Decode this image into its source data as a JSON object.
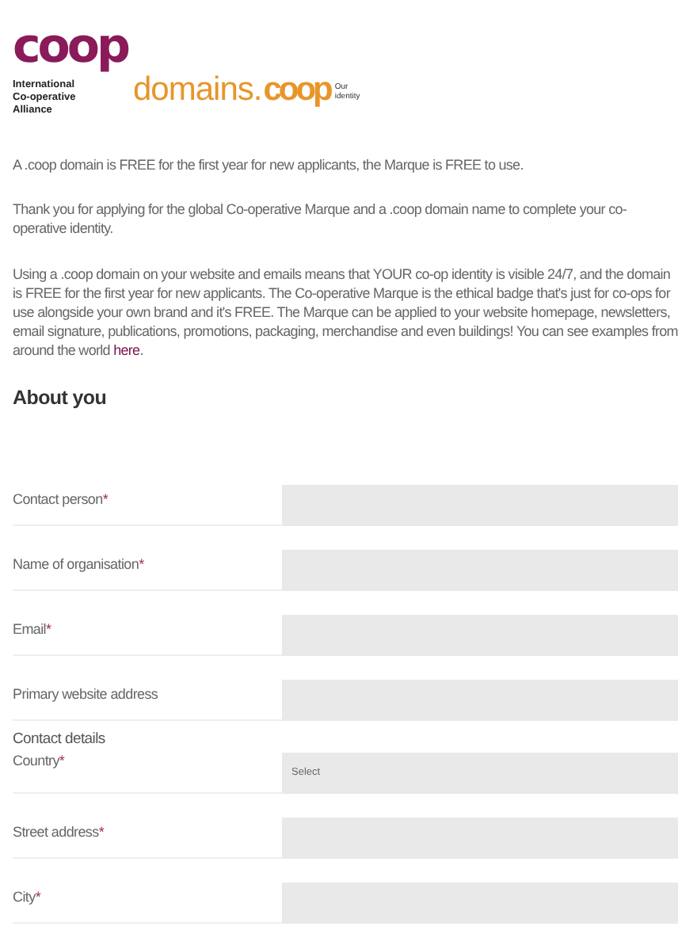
{
  "logo": {
    "mark": "coop",
    "org": [
      "International",
      "Co-operative",
      "Alliance"
    ],
    "domain": "domains.",
    "domain_mark": "coop",
    "tagline": [
      "Our",
      "identity"
    ]
  },
  "intro": [
    "A .coop domain is FREE for the first year for new applicants, the Marque is FREE to use.",
    "Thank you for applying for the global Co-operative Marque and a .coop domain name to complete your co-operative identity.",
    "Using a .coop domain on your website and emails means that YOUR co-op identity is visible 24/7, and the domain is FREE for the first year for new applicants. The Co-operative Marque is the ethical badge that's just for co-ops for use alongside your own brand and it's FREE. The Marque can be applied to your website homepage, newsletters, email signature, publications, promotions, packaging, merchandise and even buildings! You can see examples from around the world"
  ],
  "intro_link": "here",
  "intro_end": ".",
  "heading": "About you",
  "fields": [
    {
      "kind": "text",
      "label": "Contact person",
      "required": true
    },
    {
      "kind": "text",
      "label": "Name of organisation",
      "required": true
    },
    {
      "kind": "text",
      "label": "Email",
      "required": true
    },
    {
      "kind": "text",
      "label": "Primary website address",
      "required": false
    },
    {
      "kind": "section",
      "label": "Contact details"
    },
    {
      "kind": "select",
      "label": "Country",
      "required": true,
      "placeholder": "Select"
    },
    {
      "kind": "text",
      "label": "Street address",
      "required": true
    },
    {
      "kind": "text",
      "label": "City",
      "required": true
    }
  ],
  "required_mark": "*"
}
